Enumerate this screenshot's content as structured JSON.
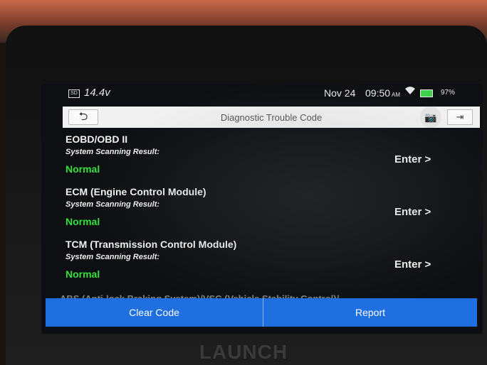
{
  "status_bar": {
    "voltage": "14.4v",
    "date": "Nov 24",
    "time": "09:50",
    "ampm": "AM",
    "battery": "97%",
    "sd_label": "SD"
  },
  "title_bar": {
    "back_glyph": "⮌",
    "title": "Diagnostic Trouble Code",
    "camera_glyph": "📷",
    "exit_glyph": "⇥"
  },
  "rows": [
    {
      "title": "EOBD/OBD II",
      "subtitle": "System Scanning Result:",
      "status": "Normal",
      "action": "Enter >"
    },
    {
      "title": "ECM (Engine Control Module)",
      "subtitle": "System Scanning Result:",
      "status": "Normal",
      "action": "Enter >"
    },
    {
      "title": "TCM (Transmission Control Module)",
      "subtitle": "System Scanning Result:",
      "status": "Normal",
      "action": "Enter >"
    }
  ],
  "partial_row": "ABS (Anti-lock Braking System)/VSC (Vehicle Stability Control)/",
  "buttons": {
    "clear": "Clear Code",
    "report": "Report"
  },
  "brand": "LAUNCH",
  "colors": {
    "accent": "#1f6fe0",
    "status_ok": "#33e23a",
    "battery": "#3fd14a"
  }
}
